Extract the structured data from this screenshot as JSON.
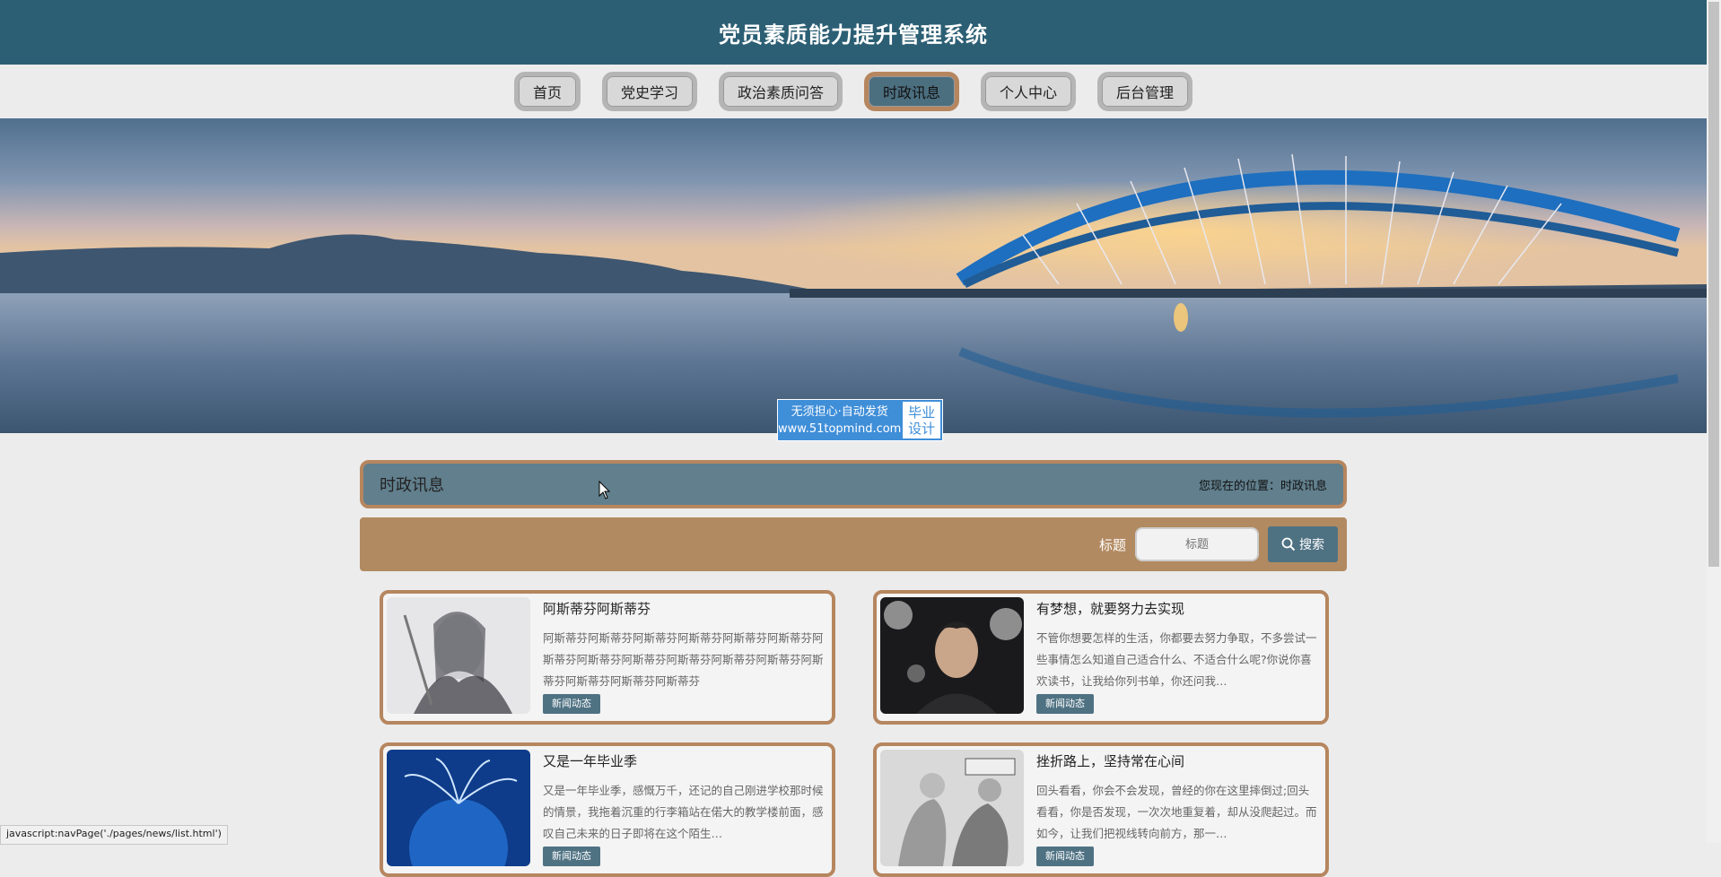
{
  "header": {
    "title": "党员素质能力提升管理系统"
  },
  "nav": {
    "items": [
      {
        "label": "首页"
      },
      {
        "label": "党史学习"
      },
      {
        "label": "政治素质问答"
      },
      {
        "label": "时政讯息"
      },
      {
        "label": "个人中心"
      },
      {
        "label": "后台管理"
      }
    ],
    "active": "时政讯息"
  },
  "watermark": {
    "line1": "无须担心·自动发货",
    "line2": "www.51topmind.com",
    "right1": "毕业",
    "right2": "设计"
  },
  "section": {
    "title": "时政讯息",
    "breadcrumb": "您现在的位置：时政讯息"
  },
  "search": {
    "label": "标题",
    "placeholder": "标题",
    "button_label": "搜索"
  },
  "news": [
    {
      "title": "阿斯蒂芬阿斯蒂芬",
      "desc": "阿斯蒂芬阿斯蒂芬阿斯蒂芬阿斯蒂芬阿斯蒂芬阿斯蒂芬阿斯蒂芬阿斯蒂芬阿斯蒂芬阿斯蒂芬阿斯蒂芬阿斯蒂芬阿斯蒂芬阿斯蒂芬阿斯蒂芬阿斯蒂芬",
      "tag": "新闻动态"
    },
    {
      "title": "有梦想，就要努力去实现",
      "desc": "不管你想要怎样的生活，你都要去努力争取，不多尝试一些事情怎么知道自己适合什么、不适合什么呢?你说你喜欢读书，让我给你列书单，你还问我…",
      "tag": "新闻动态"
    },
    {
      "title": "又是一年毕业季",
      "desc": "又是一年毕业季，感慨万千，还记的自己刚进学校那时候的情景，我拖着沉重的行李箱站在偌大的教学楼前面，感叹自己未来的日子即将在这个陌生…",
      "tag": "新闻动态"
    },
    {
      "title": "挫折路上，坚持常在心间",
      "desc": "回头看看，你会不会发现，曾经的你在这里摔倒过;回头看看，你是否发现，一次次地重复着，却从没爬起过。而如今，让我们把视线转向前方，那一…",
      "tag": "新闻动态"
    }
  ],
  "status_bar": {
    "text": "javascript:navPage('./pages/news/list.html')"
  }
}
